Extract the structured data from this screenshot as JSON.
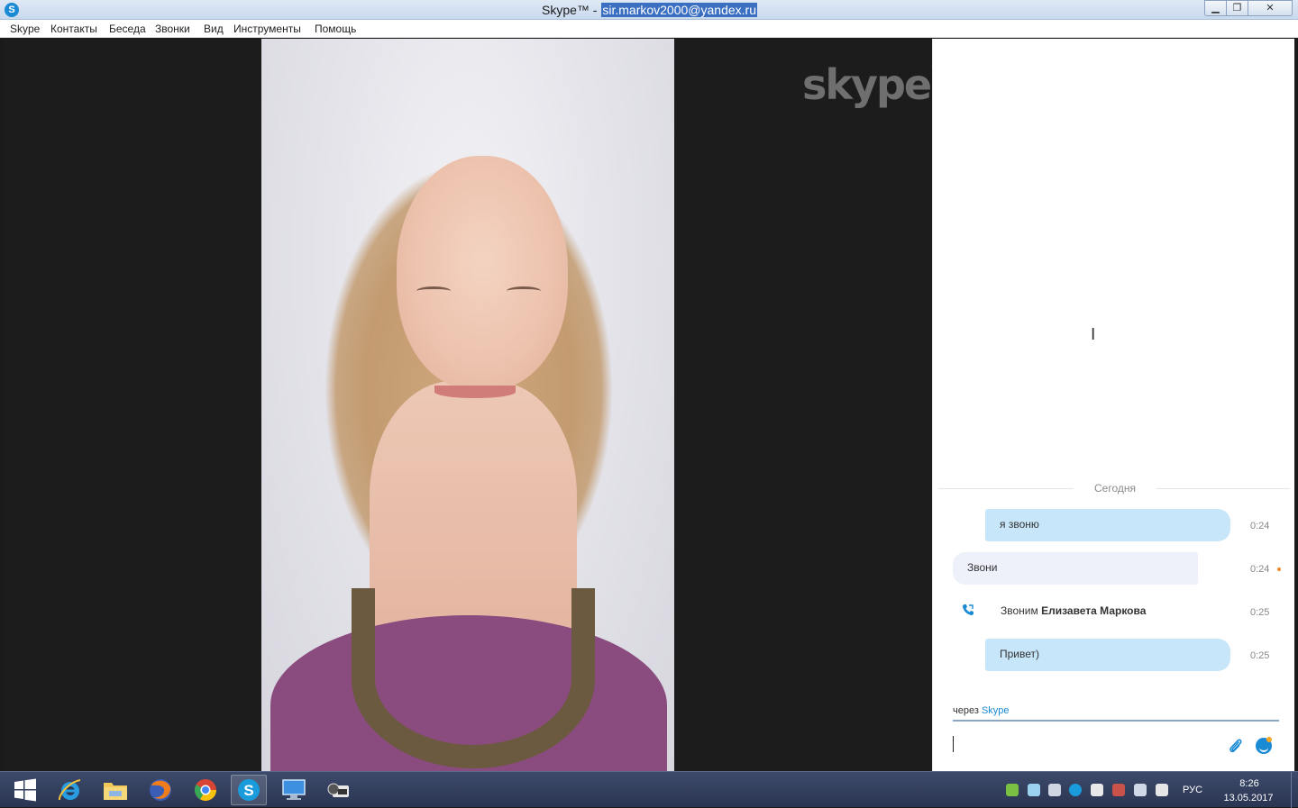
{
  "window": {
    "title_prefix": "Skype™ - ",
    "title_account": "sir.markov2000@yandex.ru",
    "app_icon_letter": "S",
    "minimize": "▁",
    "restore": "❐",
    "close": "✕"
  },
  "menu": {
    "items": [
      "Skype",
      "Контакты",
      "Беседа",
      "Звонки",
      "Вид",
      "Инструменты",
      "Помощь"
    ]
  },
  "video": {
    "watermark": "skype"
  },
  "chat": {
    "date_label": "Сегодня",
    "messages": [
      {
        "text": "я звоню",
        "time": "0:24",
        "direction": "out"
      },
      {
        "text": "Звони",
        "time": "0:24",
        "direction": "in",
        "unread": true
      },
      {
        "text_prefix": "Звоним ",
        "contact": "Елизавета Маркова",
        "time": "0:25",
        "type": "call",
        "icon": "phone-icon"
      },
      {
        "text": "Привет)",
        "time": "0:25",
        "direction": "out"
      }
    ],
    "via_prefix": "через ",
    "via_link": "Skype",
    "compose_value": "",
    "colors": {
      "accent": "#1a8ad4",
      "outgoing_bubble": "#c7e6fa",
      "incoming_bubble": "#eef0fa",
      "unread": "#f08a2c"
    }
  },
  "taskbar": {
    "apps": [
      "windows-start-icon",
      "internet-explorer-icon",
      "file-explorer-icon",
      "firefox-icon",
      "chrome-icon",
      "skype-icon",
      "desktop-icon",
      "media-icon"
    ],
    "language": "РУС",
    "time": "8:26",
    "date": "13.05.2017"
  }
}
